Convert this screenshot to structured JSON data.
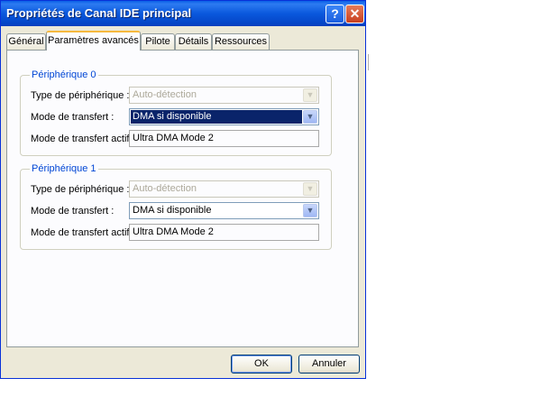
{
  "window": {
    "title": "Propriétés de Canal IDE principal",
    "help_glyph": "?",
    "close_glyph": "✕"
  },
  "tabs": [
    {
      "label": "Général",
      "active": false
    },
    {
      "label": "Paramètres avancés",
      "active": true
    },
    {
      "label": "Pilote",
      "active": false
    },
    {
      "label": "Détails",
      "active": false
    },
    {
      "label": "Ressources",
      "active": false
    }
  ],
  "devices": [
    {
      "legend": "Périphérique 0",
      "type_label": "Type de périphérique :",
      "type_value": "Auto-détection",
      "mode_label": "Mode de transfert :",
      "mode_value": "DMA si disponible",
      "active_label": "Mode de transfert actif :",
      "active_value": "Ultra DMA Mode 2"
    },
    {
      "legend": "Périphérique 1",
      "type_label": "Type de périphérique :",
      "type_value": "Auto-détection",
      "mode_label": "Mode de transfert :",
      "mode_value": "DMA si disponible",
      "active_label": "Mode de transfert actif :",
      "active_value": "Ultra DMA Mode 2"
    }
  ],
  "buttons": {
    "ok": "OK",
    "cancel": "Annuler"
  },
  "colors": {
    "titlebar": "#0a58dd",
    "legend": "#0046d5",
    "selection": "#0a246a",
    "active_tab_accent": "#f6b93e"
  },
  "icons": {
    "dropdown": "chevron-down-icon",
    "help": "help-icon",
    "close": "close-icon"
  }
}
